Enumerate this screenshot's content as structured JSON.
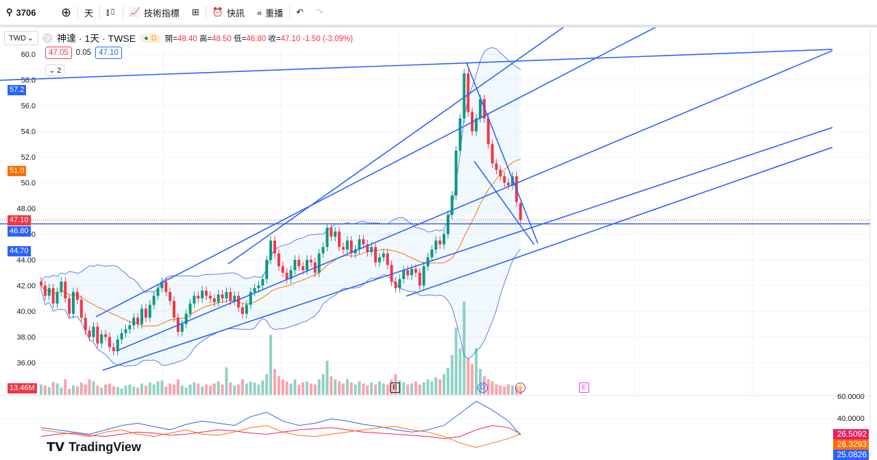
{
  "toolbar": {
    "symbol": "3706",
    "interval": "天",
    "indicators": "技術指標",
    "alerts": "快訊",
    "replay": "重播"
  },
  "legend": {
    "currency": "TWD",
    "symbol_title": "神達 · 1天 · TWSE",
    "badge": "D",
    "open_label": "開=",
    "open": "48.40",
    "high_label": "高=",
    "high": "48.50",
    "low_label": "低=",
    "low": "46.80",
    "close_label": "收=",
    "close": "47.10",
    "change": "-1.50 (-3.09%)",
    "bid": "47.05",
    "spread": "0.05",
    "ask": "47.10",
    "collapse": "2",
    "circle_num": "3"
  },
  "price_badges": {
    "line_top": "57.2",
    "ma": "51.0",
    "last": "47.10",
    "hline": "46.80",
    "bb_low": "44.70",
    "volume": "13.46M"
  },
  "markers": {
    "earnings1": "E",
    "dividend": "D",
    "split": "⚡",
    "earnings2": "E"
  },
  "osc_badges": {
    "red": "26.5092",
    "orange": "26.3293",
    "blue": "25.0826"
  },
  "osc_axis": [
    "60.0000",
    "40.0000"
  ],
  "branding": "TradingView",
  "colors": {
    "up": "#089981",
    "down": "#f23645",
    "line": "#2962ff",
    "ma": "#ff6d00",
    "band": "#5b7be8"
  },
  "chart_data": {
    "type": "candlestick",
    "price_axis": {
      "ticks": [
        "60.0",
        "58.0",
        "56.0",
        "54.0",
        "52.0",
        "50.0",
        "48.00",
        "46.00",
        "44.00",
        "42.00",
        "40.00",
        "38.00",
        "36.00"
      ],
      "range": [
        36,
        60
      ]
    },
    "closes": [
      42.0,
      41.2,
      41.8,
      40.6,
      41.5,
      42.3,
      41.0,
      39.8,
      41.5,
      40.9,
      39.5,
      38.5,
      38.0,
      38.8,
      37.5,
      38.2,
      38.0,
      37.2,
      36.9,
      37.8,
      38.3,
      38.6,
      38.9,
      39.5,
      39.0,
      40.2,
      39.5,
      40.5,
      41.2,
      41.8,
      42.3,
      41.5,
      40.8,
      39.5,
      38.4,
      39.0,
      39.8,
      40.6,
      41.2,
      41.0,
      41.6,
      41.2,
      41.0,
      40.7,
      41.3,
      41.0,
      41.5,
      40.8,
      41.2,
      40.3,
      39.8,
      40.5,
      41.5,
      41.8,
      42.0,
      42.5,
      44.0,
      45.5,
      44.5,
      43.5,
      43.0,
      42.5,
      43.2,
      44.0,
      43.5,
      43.2,
      44.0,
      43.8,
      43.0,
      44.5,
      45.0,
      46.5,
      45.8,
      46.2,
      45.0,
      44.8,
      45.5,
      44.5,
      44.8,
      45.6,
      45.2,
      44.6,
      45.0,
      43.8,
      44.2,
      44.5,
      43.6,
      42.3,
      41.8,
      42.5,
      43.2,
      42.8,
      43.3,
      43.0,
      42.0,
      43.5,
      44.2,
      44.8,
      45.5,
      45.2,
      46.0,
      47.5,
      49.0,
      52.5,
      55.0,
      58.5,
      55.5,
      54.0,
      55.0,
      56.5,
      55.0,
      53.0,
      51.5,
      51.0,
      50.5,
      50.0,
      49.8,
      50.5,
      48.5,
      47.1
    ],
    "last_ohlc": {
      "open": 48.4,
      "high": 48.5,
      "low": 46.8,
      "close": 47.1
    },
    "volume_m": [
      20,
      18,
      15,
      25,
      22,
      14,
      30,
      12,
      18,
      16,
      24,
      20,
      30,
      26,
      18,
      14,
      20,
      22,
      17,
      15,
      12,
      18,
      20,
      16,
      14,
      22,
      18,
      24,
      20,
      26,
      28,
      16,
      22,
      20,
      30,
      18,
      14,
      20,
      24,
      22,
      16,
      20,
      18,
      22,
      26,
      20,
      53,
      24,
      18,
      20,
      30,
      22,
      26,
      24,
      20,
      28,
      40,
      116,
      50,
      36,
      30,
      26,
      22,
      30,
      20,
      24,
      26,
      22,
      20,
      30,
      40,
      66,
      36,
      30,
      26,
      22,
      30,
      24,
      20,
      26,
      22,
      18,
      24,
      20,
      26,
      22,
      20,
      30,
      40,
      28,
      24,
      20,
      22,
      26,
      20,
      24,
      30,
      26,
      34,
      30,
      40,
      52,
      77,
      130,
      90,
      180,
      70,
      60,
      90,
      50,
      36,
      30,
      26,
      20,
      18,
      16,
      20,
      18,
      16,
      13.46
    ],
    "bb_period": 20,
    "bb_mult": 2,
    "ma_period": 20,
    "drawings": [
      {
        "name": "trendline-resistance-top",
        "a": [
          -10.2,
          57.97
        ],
        "b": [
          196.4,
          60.37
        ]
      },
      {
        "name": "trendline-steep-1",
        "a": [
          46.4,
          43.68
        ],
        "b": [
          130.1,
          62.19
        ]
      },
      {
        "name": "trendline-steep-2",
        "a": [
          13.6,
          39.57
        ],
        "b": [
          153.1,
          62.19
        ]
      },
      {
        "name": "trendline-mid",
        "a": [
          18.7,
          36.91
        ],
        "b": [
          196.4,
          60.27
        ]
      },
      {
        "name": "trendline-channel-low-1",
        "a": [
          90.6,
          41.17
        ],
        "b": [
          196.4,
          52.75
        ]
      },
      {
        "name": "trendline-channel-low-2",
        "a": [
          15.3,
          35.41
        ],
        "b": [
          196.4,
          54.29
        ]
      },
      {
        "name": "trendline-falling-1",
        "a": [
          105.6,
          59.31
        ],
        "b": [
          123.3,
          45.28
        ]
      },
      {
        "name": "trendline-falling-2",
        "a": [
          107.5,
          51.68
        ],
        "b": [
          122.4,
          45.17
        ]
      }
    ],
    "hline": 46.8,
    "oscillator": {
      "range": [
        20,
        60
      ],
      "step": 4,
      "blue": [
        32,
        30,
        28,
        26,
        30,
        34,
        36,
        33,
        30,
        35,
        38,
        36,
        34,
        42,
        46,
        38,
        34,
        36,
        40,
        38,
        35,
        33,
        30,
        28,
        30,
        34,
        45,
        56,
        48,
        38,
        25.08
      ],
      "red": [
        24,
        26,
        27,
        25,
        24,
        26,
        28,
        27,
        25,
        26,
        28,
        30,
        29,
        27,
        26,
        28,
        30,
        31,
        32,
        30,
        28,
        27,
        26,
        25,
        24,
        22,
        24,
        30,
        34,
        32,
        26.51
      ],
      "orange": [
        30,
        28,
        26,
        24,
        28,
        30,
        26,
        24,
        27,
        30,
        26,
        25,
        28,
        32,
        34,
        28,
        25,
        24,
        26,
        28,
        30,
        32,
        33,
        30,
        28,
        24,
        18,
        14,
        18,
        22,
        26.33
      ]
    }
  }
}
